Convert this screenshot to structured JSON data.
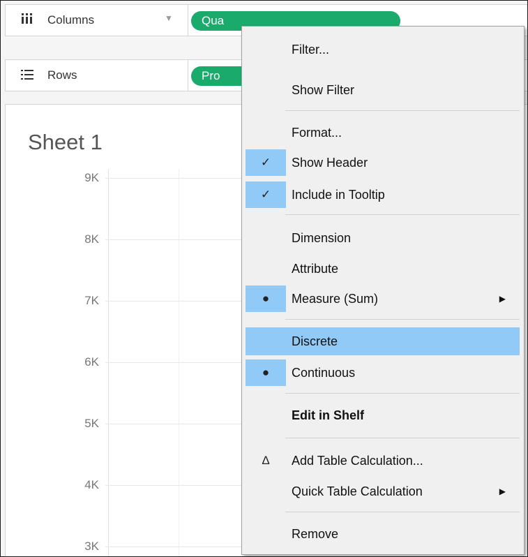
{
  "shelves": {
    "columns": {
      "label": "Columns",
      "icon": "columns-icon",
      "pill": "Qua"
    },
    "rows": {
      "label": "Rows",
      "icon": "rows-icon",
      "pill": "Pro"
    }
  },
  "sheet": {
    "title": "Sheet 1",
    "y_ticks": [
      "9K",
      "8K",
      "7K",
      "6K",
      "5K",
      "4K",
      "3K"
    ]
  },
  "context_menu": {
    "items": [
      {
        "label": "Filter..."
      },
      {
        "label": "Show Filter"
      },
      {
        "label": "Format..."
      },
      {
        "label": "Show Header",
        "mark": "✓",
        "checked": true
      },
      {
        "label": "Include in Tooltip",
        "mark": "✓",
        "checked": true
      },
      {
        "label": "Dimension"
      },
      {
        "label": "Attribute"
      },
      {
        "label": "Measure (Sum)",
        "mark": "●",
        "checked": true,
        "submenu": true
      },
      {
        "label": "Discrete",
        "highlighted": true
      },
      {
        "label": "Continuous",
        "mark": "●",
        "checked": true
      },
      {
        "label": "Edit in Shelf",
        "bold": true
      },
      {
        "label": "Add Table Calculation...",
        "mark": "Δ"
      },
      {
        "label": "Quick Table Calculation",
        "submenu": true
      },
      {
        "label": "Remove"
      }
    ]
  },
  "colors": {
    "pill": "#1aab6c",
    "menu_highlight": "#91c9f7",
    "menu_bg": "#f0f0f0"
  }
}
